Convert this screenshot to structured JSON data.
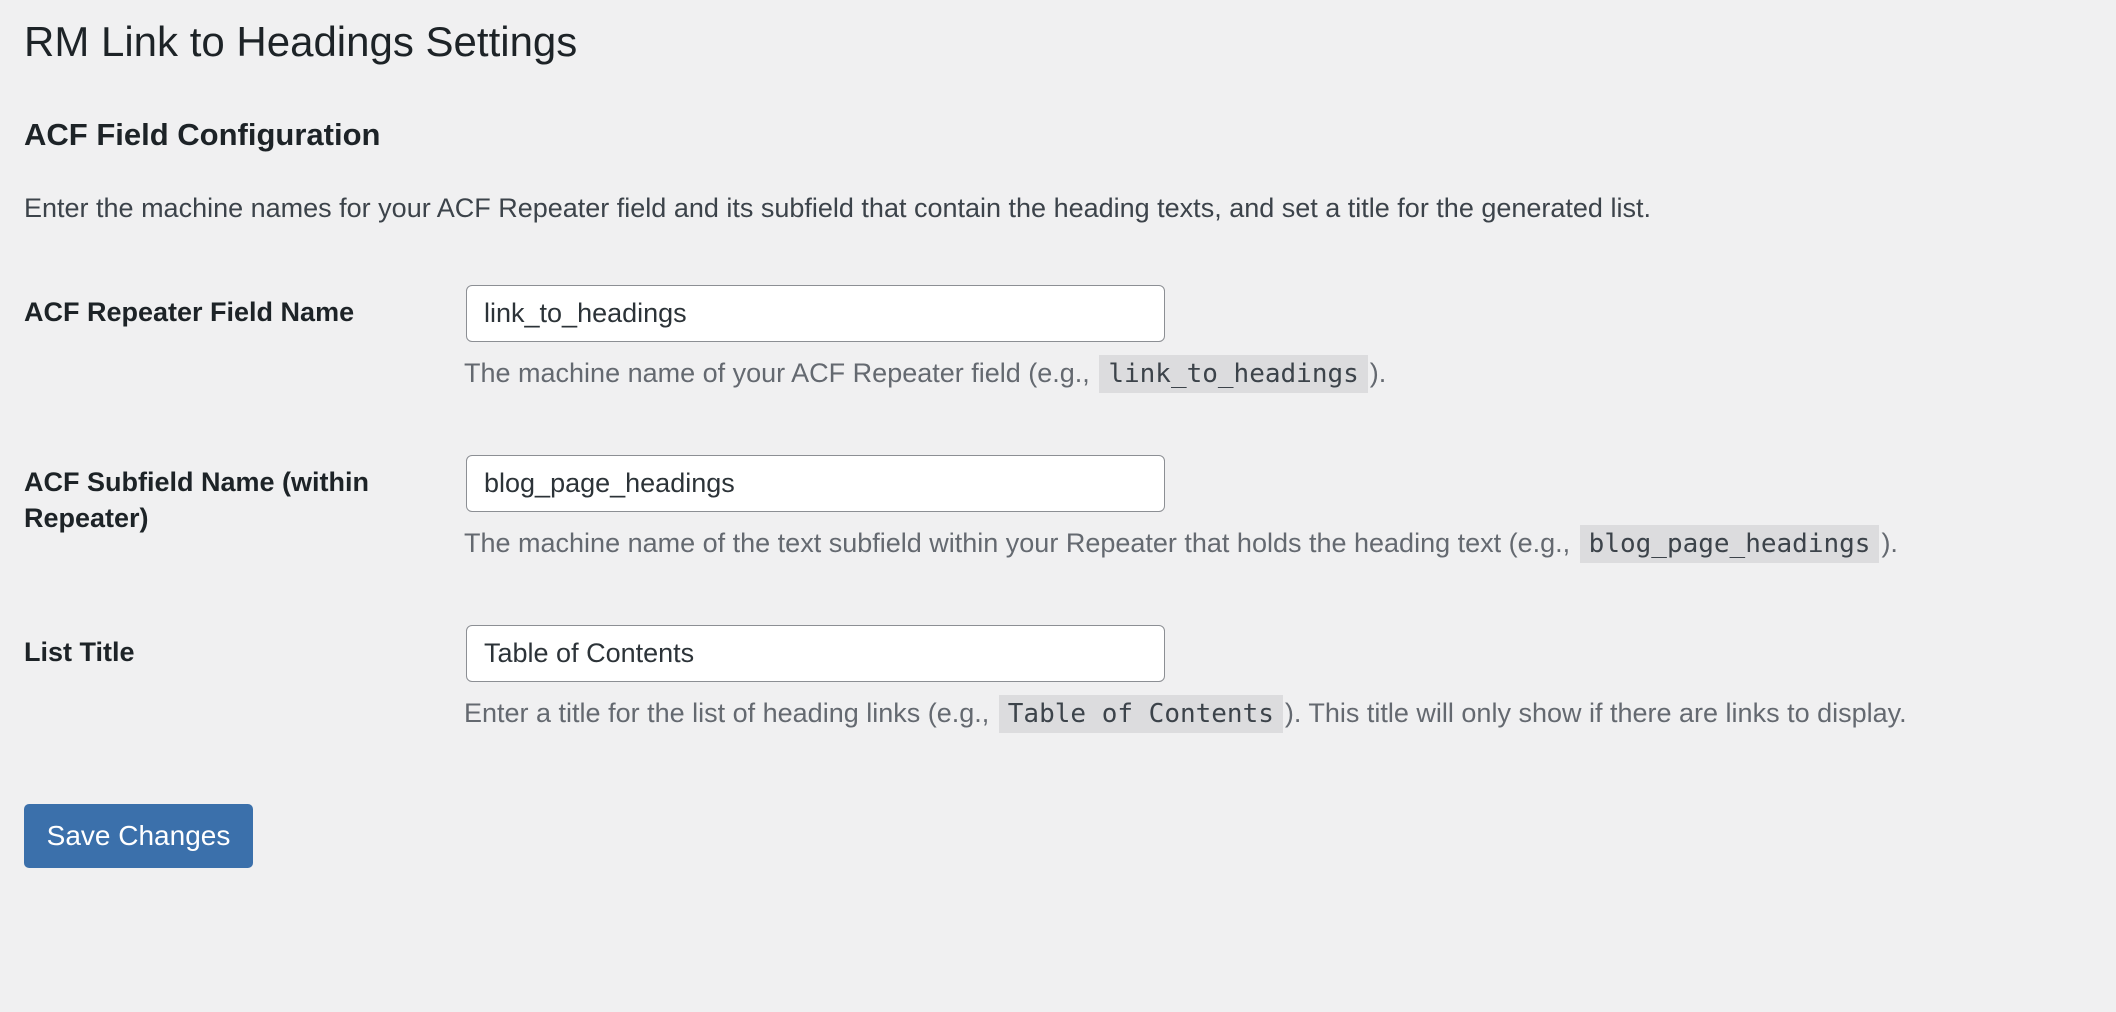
{
  "page": {
    "title": "RM Link to Headings Settings"
  },
  "section": {
    "heading": "ACF Field Configuration",
    "description": "Enter the machine names for your ACF Repeater field and its subfield that contain the heading texts, and set a title for the generated list."
  },
  "fields": [
    {
      "label": "ACF Repeater Field Name",
      "value": "link_to_headings",
      "help_before": "The machine name of your ACF Repeater field (e.g., ",
      "help_code": "link_to_headings",
      "help_after": ")."
    },
    {
      "label": "ACF Subfield Name (within Repeater)",
      "value": "blog_page_headings",
      "help_before": "The machine name of the text subfield within your Repeater that holds the heading text (e.g., ",
      "help_code": "blog_page_headings",
      "help_after": ")."
    },
    {
      "label": "List Title",
      "value": "Table of Contents",
      "help_before": "Enter a title for the list of heading links (e.g., ",
      "help_code": "Table of Contents",
      "help_after": "). This title will only show if there are links to display."
    }
  ],
  "actions": {
    "save_label": "Save Changes"
  },
  "colors": {
    "primary": "#3b70ab",
    "background": "#f0f0f1"
  }
}
